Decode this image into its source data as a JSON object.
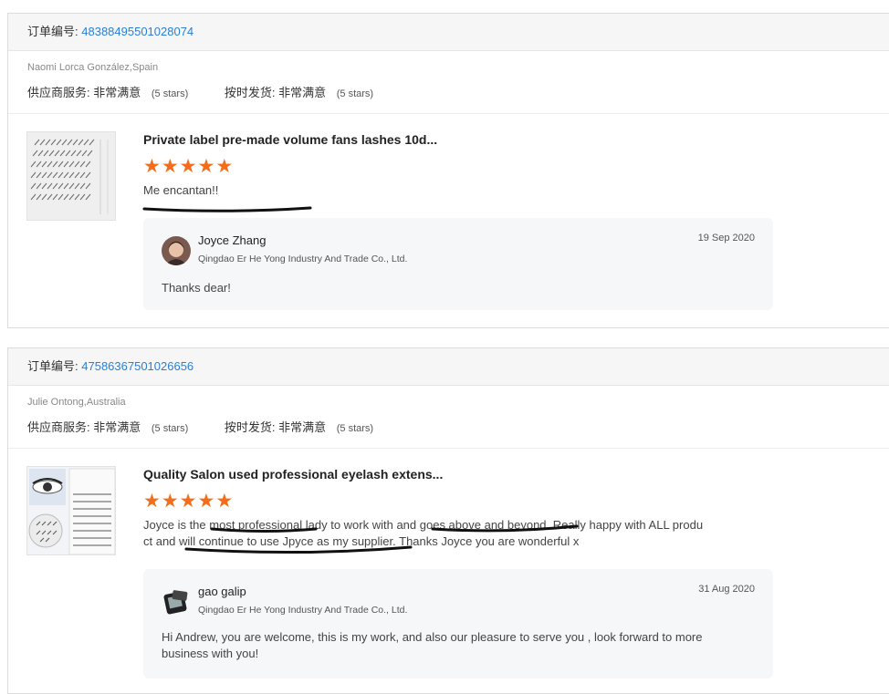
{
  "orders": [
    {
      "order_label": "订单编号:",
      "order_number": "48388495501028074",
      "buyer": "Naomi Lorca González,Spain",
      "service_label": "供应商服务:",
      "service_value": "非常满意",
      "service_stars": "(5 stars)",
      "shipping_label": "按时发货:",
      "shipping_value": "非常满意",
      "shipping_stars": "(5 stars)",
      "product_title": "Private label pre-made volume fans lashes 10d...",
      "rating": 5,
      "review_line1": "Me encantan!!",
      "review_line2": "",
      "reply": {
        "name": "Joyce Zhang",
        "company": "Qingdao Er He Yong Industry And Trade Co., Ltd.",
        "date": "19 Sep 2020",
        "text": "Thanks dear!"
      }
    },
    {
      "order_label": "订单编号:",
      "order_number": "47586367501026656",
      "buyer": "Julie Ontong,Australia",
      "service_label": "供应商服务:",
      "service_value": "非常满意",
      "service_stars": "(5 stars)",
      "shipping_label": "按时发货:",
      "shipping_value": "非常满意",
      "shipping_stars": "(5 stars)",
      "product_title": "Quality Salon used professional eyelash extens...",
      "rating": 5,
      "review_line1": "Joyce is the most professional lady to work with and goes above and beyond. Really happy with ALL produ",
      "review_line2": "ct and will continue to use Jpyce as my supplier. Thanks Joyce you are wonderful x",
      "reply": {
        "name": "gao galip",
        "company": "Qingdao Er He Yong Industry And Trade Co., Ltd.",
        "date": "31 Aug 2020",
        "text_line1": "Hi Andrew, you are welcome, this is my work, and also our pleasure to serve you , look forward to more",
        "text_line2": "business with you!"
      }
    }
  ],
  "colors": {
    "accent_link": "#2a7fd4",
    "star": "#f36d1b"
  },
  "icons": {
    "star": "star-icon"
  }
}
